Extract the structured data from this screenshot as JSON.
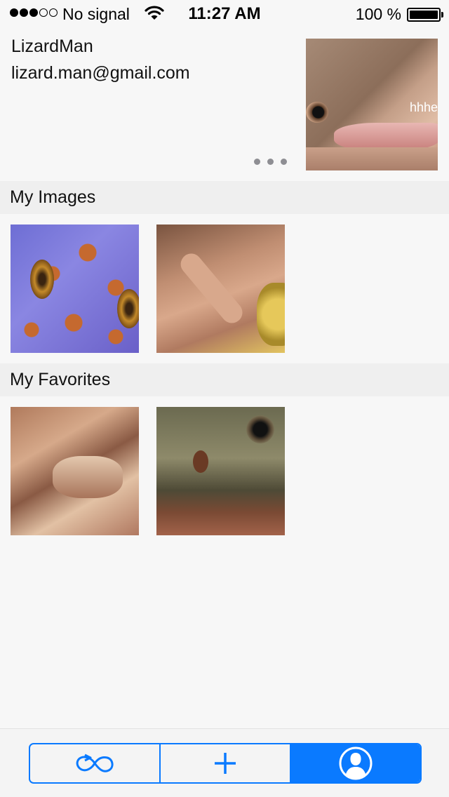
{
  "status_bar": {
    "carrier": "No signal",
    "time": "11:27 AM",
    "battery_percent": "100 %",
    "signal_bars": [
      true,
      true,
      true,
      false,
      false
    ]
  },
  "profile": {
    "name": "LizardMan",
    "email": "lizard.man@gmail.com",
    "avatar_caption": "hhhe",
    "more_icon": "ellipsis-icon"
  },
  "sections": {
    "my_images": {
      "title": "My Images"
    },
    "my_favorites": {
      "title": "My Favorites"
    }
  },
  "tab_bar": {
    "segments": [
      {
        "icon": "infinity-refresh-icon",
        "active": false
      },
      {
        "icon": "plus-icon",
        "active": false
      },
      {
        "icon": "profile-icon",
        "active": true
      }
    ]
  },
  "colors": {
    "accent": "#0a7aff",
    "background": "#f7f7f7",
    "section_header": "#efefef"
  }
}
